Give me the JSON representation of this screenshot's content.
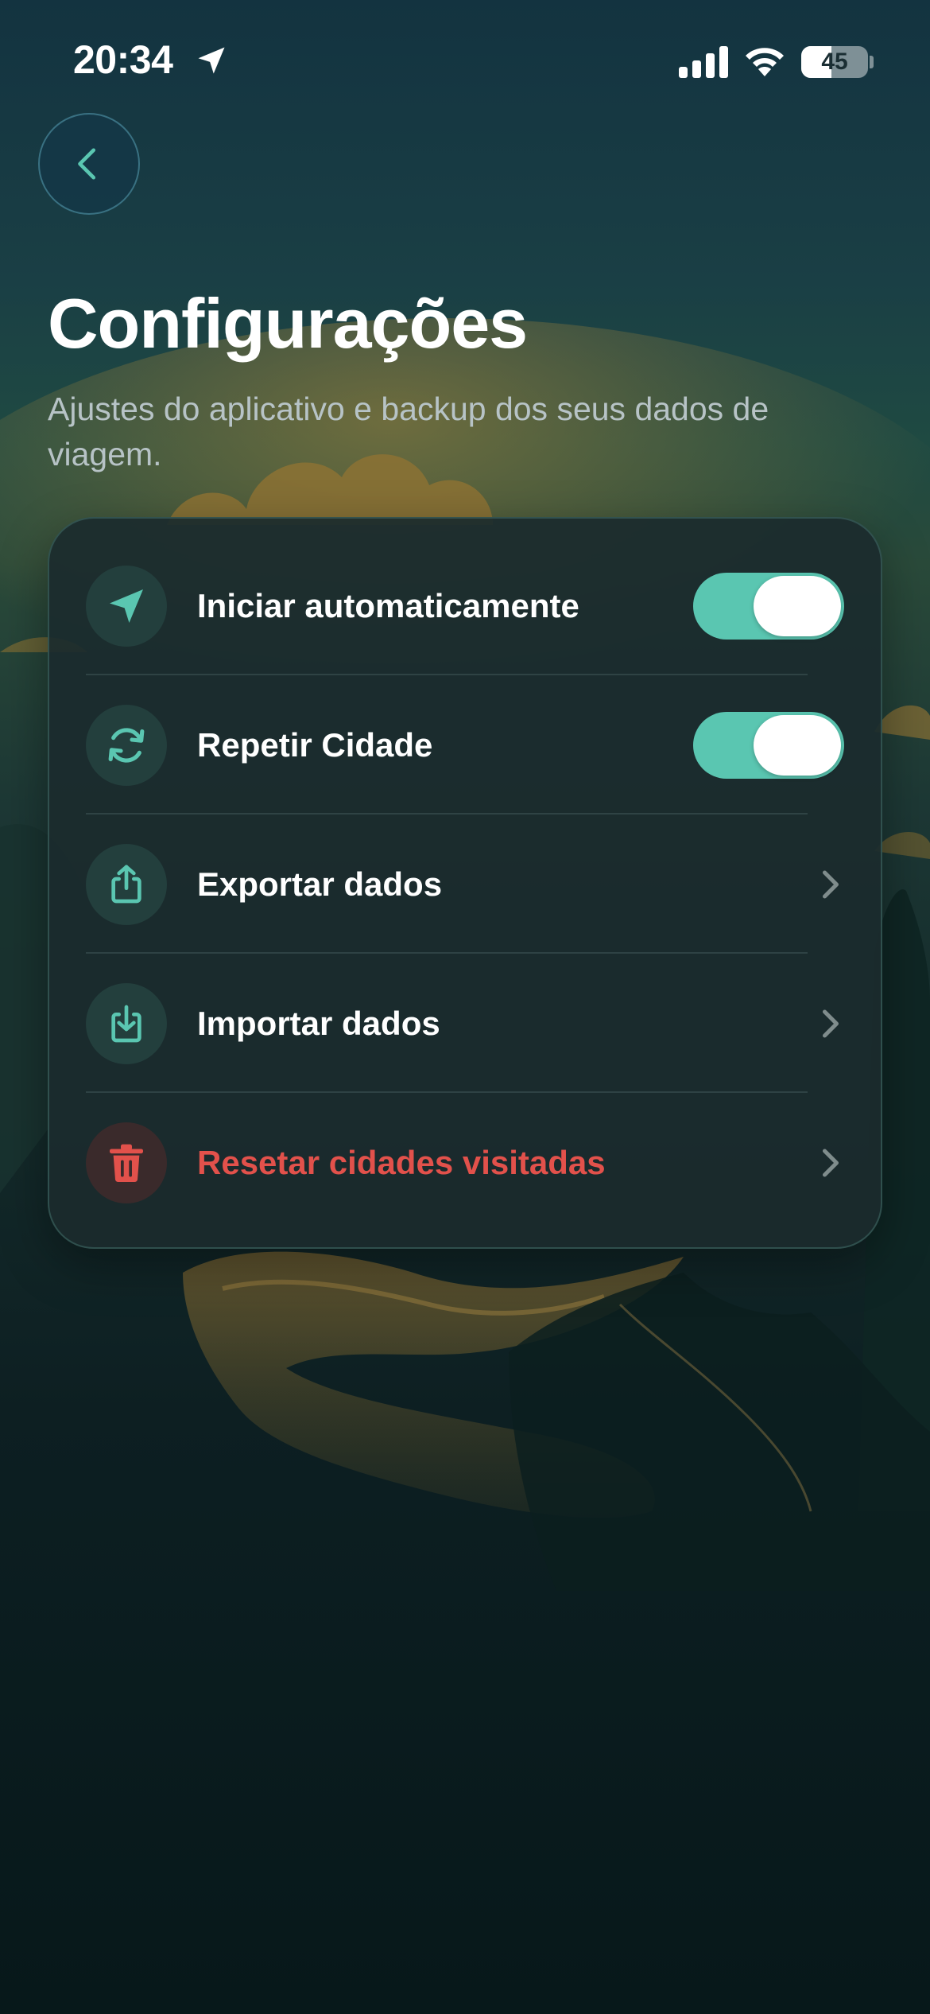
{
  "status_bar": {
    "time": "20:34",
    "battery_level": "45",
    "battery_fraction": 0.45
  },
  "header": {
    "back_icon": "chevron-left-icon",
    "title": "Configurações",
    "subtitle": "Ajustes do aplicativo e backup dos seus dados de viagem."
  },
  "settings": {
    "items": [
      {
        "label": "Iniciar automaticamente",
        "icon": "navigation-arrow-icon",
        "control": "toggle",
        "enabled": true
      },
      {
        "label": "Repetir Cidade",
        "icon": "refresh-icon",
        "control": "toggle",
        "enabled": true
      },
      {
        "label": "Exportar dados",
        "icon": "share-upload-icon",
        "control": "chevron"
      },
      {
        "label": "Importar dados",
        "icon": "download-icon",
        "control": "chevron"
      },
      {
        "label": "Resetar cidades visitadas",
        "icon": "trash-icon",
        "control": "chevron",
        "destructive": true
      }
    ]
  },
  "colors": {
    "accent": "#5ac6b1",
    "danger": "#e2514b",
    "card_background": "#1b2b2d",
    "icon_background": "#233f3d"
  }
}
